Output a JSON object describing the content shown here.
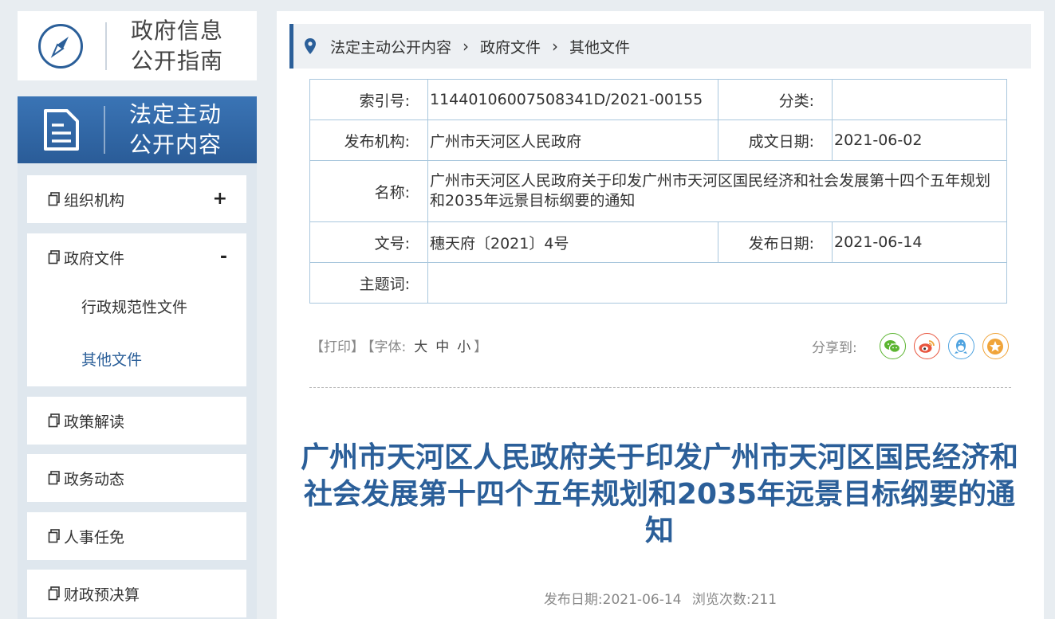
{
  "guide": {
    "line1": "政府信息",
    "line2": "公开指南"
  },
  "section": {
    "line1": "法定主动",
    "line2": "公开内容"
  },
  "menu": [
    {
      "label": "组织机构",
      "toggle": "+"
    },
    {
      "label": "政府文件",
      "toggle": "-",
      "sub": [
        "行政规范性文件",
        "其他文件"
      ]
    },
    {
      "label": "政策解读"
    },
    {
      "label": "政务动态"
    },
    {
      "label": "人事任免"
    },
    {
      "label": "财政预决算"
    }
  ],
  "breadcrumb": [
    "法定主动公开内容",
    "政府文件",
    "其他文件"
  ],
  "meta": {
    "index_label": "索引号:",
    "index_value": "11440106007508341D/2021-00155",
    "category_label": "分类:",
    "category_value": "",
    "issuer_label": "发布机构:",
    "issuer_value": "广州市天河区人民政府",
    "written_label": "成文日期:",
    "written_value": "2021-06-02",
    "name_label": "名称:",
    "name_value": "广州市天河区人民政府关于印发广州市天河区国民经济和社会发展第十四个五年规划和2035年远景目标纲要的通知",
    "docno_label": "文号:",
    "docno_value": "穗天府〔2021〕4号",
    "pubdate_label": "发布日期:",
    "pubdate_value": "2021-06-14",
    "keyword_label": "主题词:",
    "keyword_value": ""
  },
  "tools": {
    "print": "【打印】",
    "font_open": "【字体:",
    "large": "大",
    "medium": "中",
    "small": "小",
    "font_close": "】"
  },
  "share": {
    "label": "分享到:"
  },
  "article": {
    "title": "广州市天河区人民政府关于印发广州市天河区国民经济和社会发展第十四个五年规划和2035年远景目标纲要的通知",
    "pub_label": "发布日期:",
    "pub_date": "2021-06-14",
    "views_label": "浏览次数:",
    "views": "211"
  },
  "colors": {
    "accent": "#2b5f99",
    "wechat": "#5cb531",
    "weibo": "#e8553e",
    "qq": "#4fa3e0",
    "favorite": "#f0a43a"
  }
}
